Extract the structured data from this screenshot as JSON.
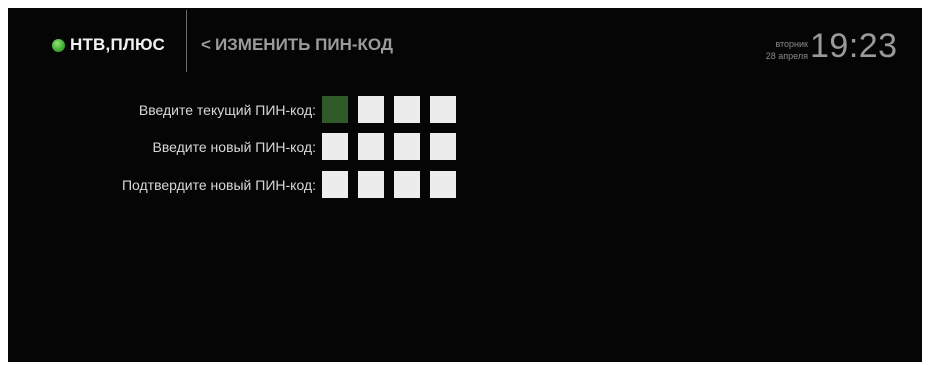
{
  "header": {
    "logo_text": "НТВ,ПЛЮС",
    "back_chevron": "<",
    "page_title": "ИЗМЕНИТЬ ПИН-КОД",
    "day": "вторник",
    "date": "28 апреля",
    "time": "19:23"
  },
  "form": {
    "rows": [
      {
        "label": "Введите текущий ПИН-код:",
        "digits_entered": 0,
        "focused_box": 1
      },
      {
        "label": "Введите новый ПИН-код:",
        "digits_entered": 0
      },
      {
        "label": "Подтвердите новый ПИН-код:",
        "digits_entered": 0
      }
    ]
  },
  "colors": {
    "background": "#050505",
    "brand_dot": "#46b136",
    "active_box": "#2f5a27",
    "empty_box": "#ececec"
  }
}
